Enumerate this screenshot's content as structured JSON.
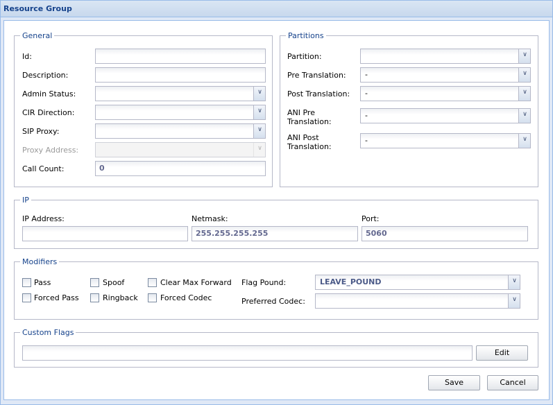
{
  "window": {
    "title": "Resource Group"
  },
  "general": {
    "legend": "General",
    "id_label": "Id:",
    "id_value": "",
    "description_label": "Description:",
    "description_value": "",
    "admin_status_label": "Admin Status:",
    "admin_status_value": "",
    "cir_direction_label": "CIR Direction:",
    "cir_direction_value": "",
    "sip_proxy_label": "SIP Proxy:",
    "sip_proxy_value": "",
    "proxy_address_label": "Proxy Address:",
    "proxy_address_value": "",
    "call_count_label": "Call Count:",
    "call_count_value": "0"
  },
  "partitions": {
    "legend": "Partitions",
    "partition_label": "Partition:",
    "partition_value": "",
    "pre_translation_label": "Pre Translation:",
    "pre_translation_value": "-",
    "post_translation_label": "Post Translation:",
    "post_translation_value": "-",
    "ani_pre_label_1": "ANI Pre",
    "ani_pre_label_2": "Translation:",
    "ani_pre_value": "-",
    "ani_post_label_1": "ANI Post",
    "ani_post_label_2": "Translation:",
    "ani_post_value": "-"
  },
  "ip": {
    "legend": "IP",
    "ip_address_label": "IP Address:",
    "ip_address_value": "",
    "netmask_label": "Netmask:",
    "netmask_value": "255.255.255.255",
    "port_label": "Port:",
    "port_value": "5060"
  },
  "modifiers": {
    "legend": "Modifiers",
    "pass_label": "Pass",
    "forced_pass_label": "Forced Pass",
    "spoof_label": "Spoof",
    "ringback_label": "Ringback",
    "clear_max_forward_label": "Clear Max Forward",
    "forced_codec_label": "Forced Codec",
    "flag_pound_label": "Flag Pound:",
    "flag_pound_value": "LEAVE_POUND",
    "preferred_codec_label": "Preferred Codec:",
    "preferred_codec_value": ""
  },
  "custom_flags": {
    "legend": "Custom Flags",
    "value": "",
    "edit_label": "Edit"
  },
  "footer": {
    "save_label": "Save",
    "cancel_label": "Cancel"
  },
  "icons": {
    "dropdown": "chevron-down-icon"
  }
}
